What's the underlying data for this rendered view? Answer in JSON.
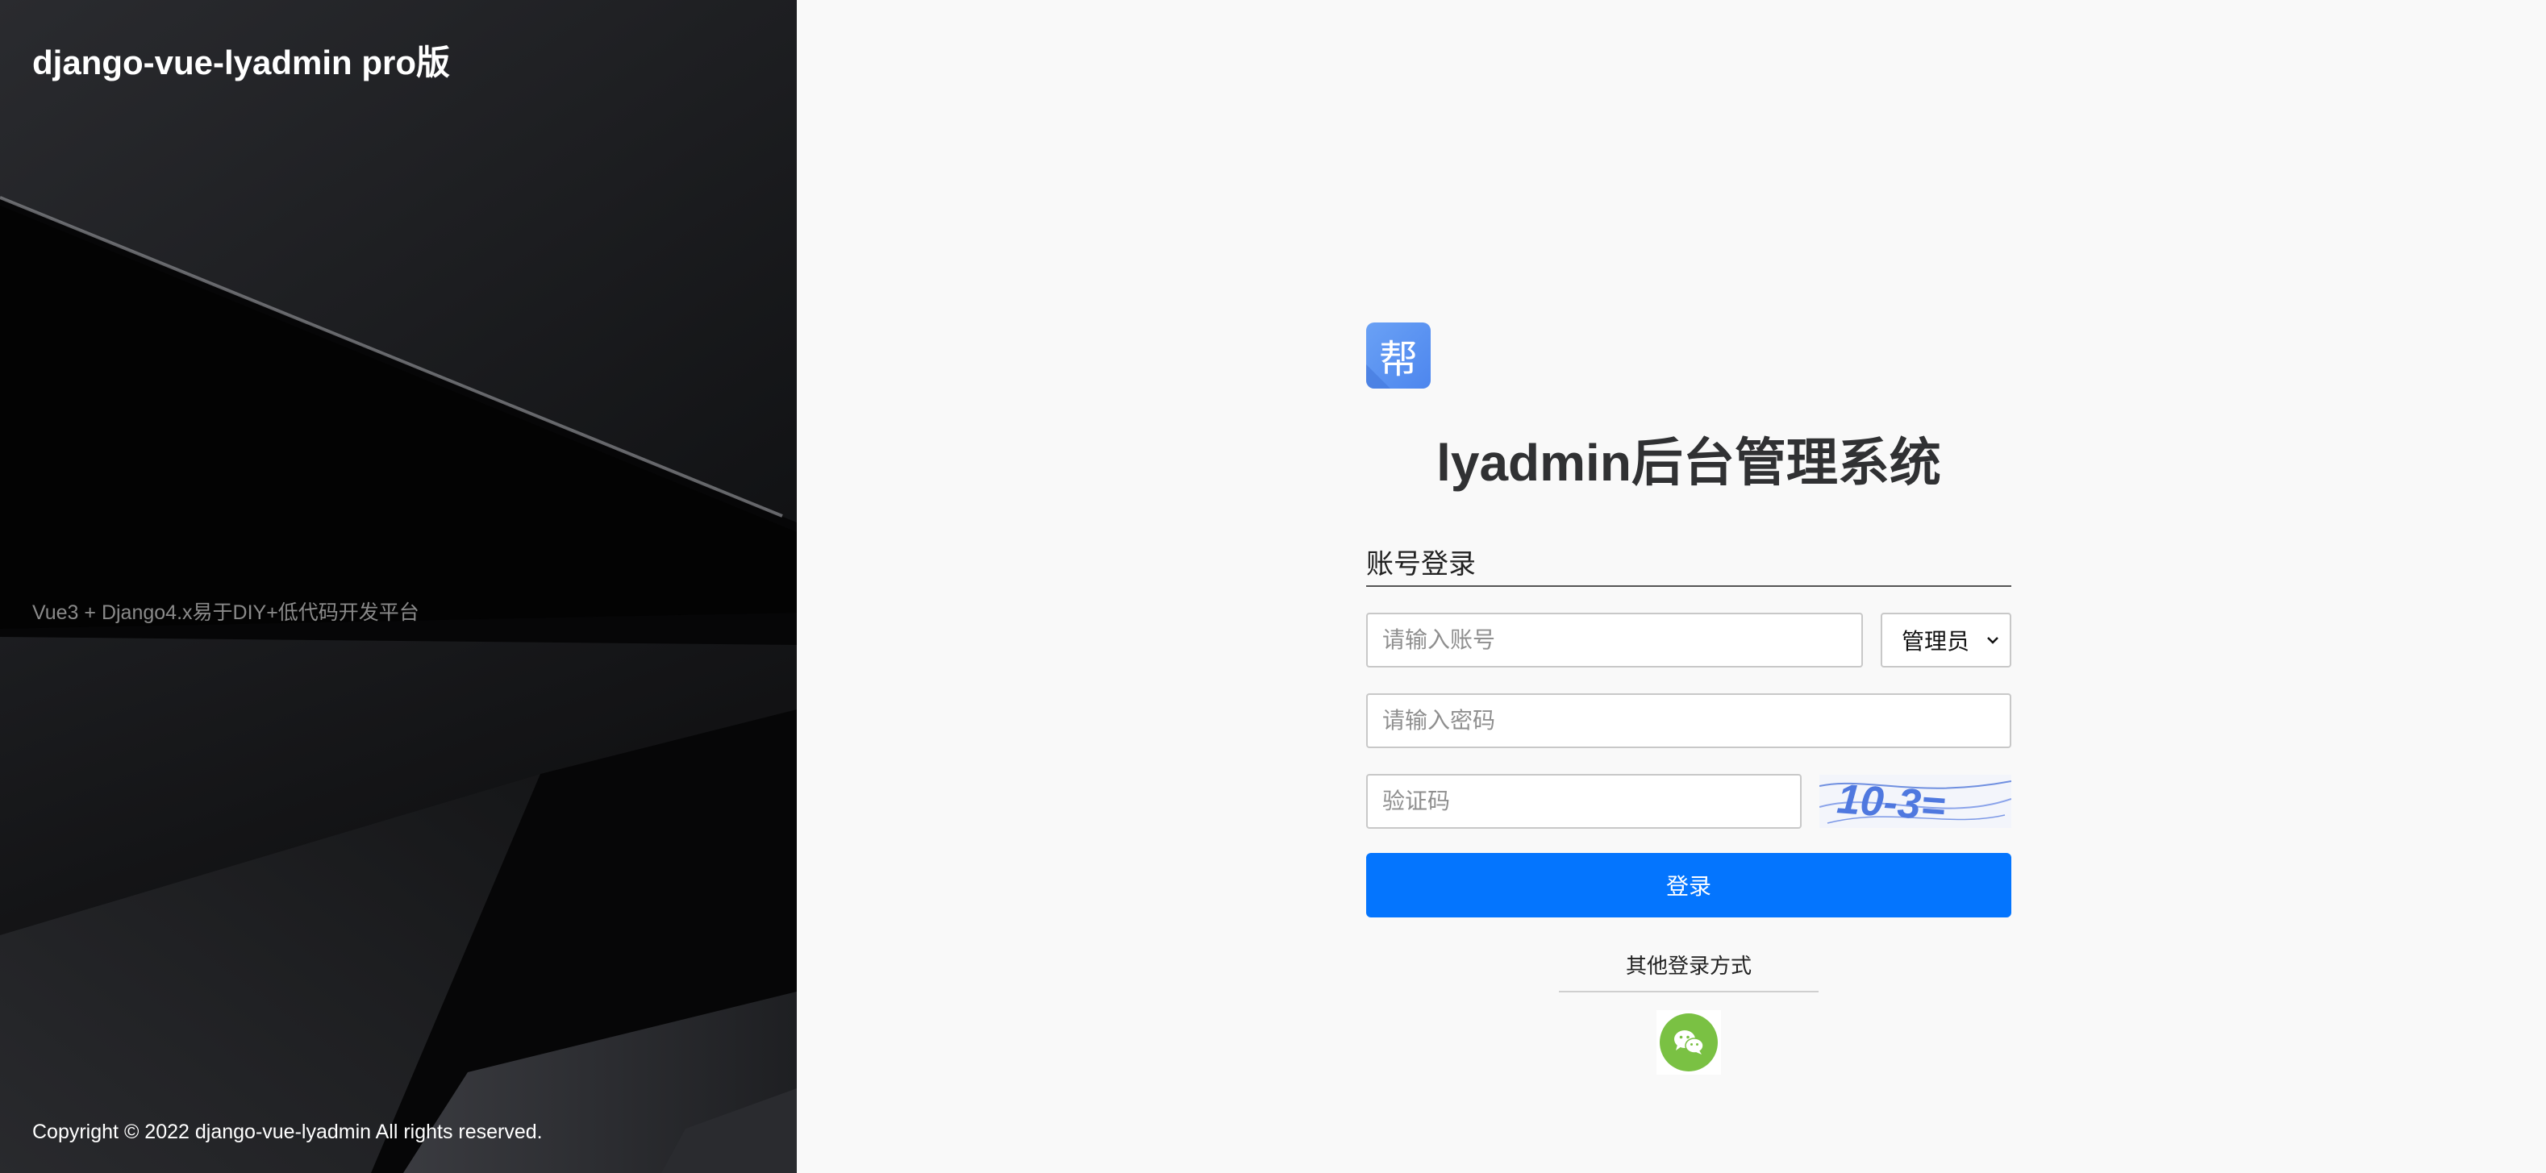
{
  "brand": {
    "title": "django-vue-lyadmin pro版",
    "slogan": "Vue3 + Django4.x易于DIY+低代码开发平台",
    "copyright": "Copyright © 2022 django-vue-lyadmin All rights reserved."
  },
  "login": {
    "logo_char": "帮",
    "system_title": "lyadmin后台管理系统",
    "tab_label": "账号登录",
    "account": {
      "placeholder": "请输入账号",
      "value": ""
    },
    "role": {
      "selected": "管理员"
    },
    "password": {
      "placeholder": "请输入密码",
      "value": ""
    },
    "captcha": {
      "placeholder": "验证码",
      "value": "",
      "image_text": "10-3="
    },
    "submit_label": "登录",
    "other_login_label": "其他登录方式",
    "other_login_icon": "wechat-icon"
  },
  "colors": {
    "primary": "#0475fe",
    "wechat": "#7ac143",
    "logo": "#5b92f1",
    "left_bg": "#050506"
  }
}
